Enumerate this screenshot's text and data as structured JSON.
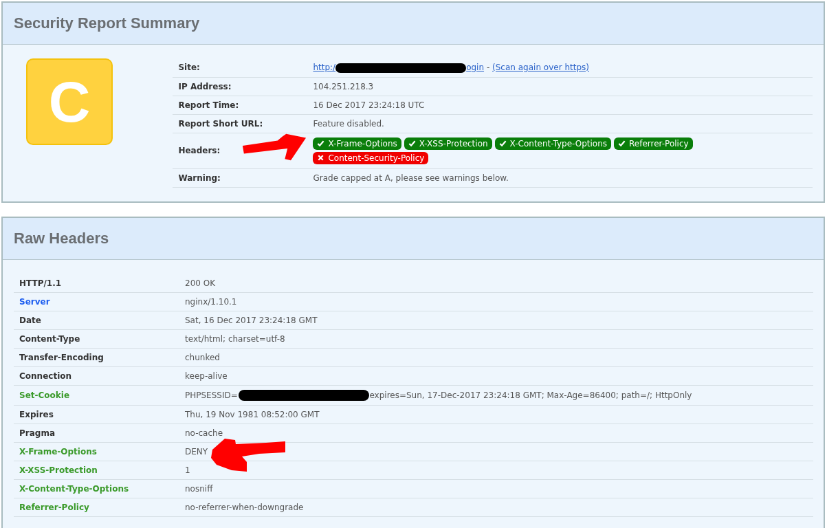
{
  "summary": {
    "title": "Security Report Summary",
    "grade": "C",
    "site": {
      "label": "Site:",
      "link_start": "http:/",
      "link_end": "ogin",
      "separator": "-",
      "rescan": "(Scan again over https)"
    },
    "rows": [
      {
        "label": "IP Address:",
        "value": "104.251.218.3"
      },
      {
        "label": "Report Time:",
        "value": "16 Dec 2017 23:24:18 UTC"
      },
      {
        "label": "Report Short URL:",
        "value": "Feature disabled."
      }
    ],
    "headers": {
      "label": "Headers:",
      "badges": [
        {
          "text": "X-Frame-Options",
          "passed": true
        },
        {
          "text": "X-XSS-Protection",
          "passed": true
        },
        {
          "text": "X-Content-Type-Options",
          "passed": true
        },
        {
          "text": "Referrer-Policy",
          "passed": true
        },
        {
          "text": "Content-Security-Policy",
          "passed": false
        }
      ]
    },
    "warning": {
      "label": "Warning:",
      "value": "Grade capped at A, please see warnings below."
    }
  },
  "raw_headers": {
    "title": "Raw Headers",
    "rows": [
      {
        "name": "HTTP/1.1",
        "value": "200 OK",
        "color": "#333333"
      },
      {
        "name": "Server",
        "value": "nginx/1.10.1",
        "color": "#1f5ff0"
      },
      {
        "name": "Date",
        "value": "Sat, 16 Dec 2017 23:24:18 GMT",
        "color": "#333333"
      },
      {
        "name": "Content-Type",
        "value": "text/html; charset=utf-8",
        "color": "#333333"
      },
      {
        "name": "Transfer-Encoding",
        "value": "chunked",
        "color": "#333333"
      },
      {
        "name": "Connection",
        "value": "keep-alive",
        "color": "#333333"
      },
      {
        "name": "Set-Cookie",
        "value": "PHPSESSID=",
        "value_end": "expires=Sun, 17-Dec-2017 23:24:18 GMT; Max-Age=86400; path=/; HttpOnly",
        "color": "#3a9a2a"
      },
      {
        "name": "Expires",
        "value": "Thu, 19 Nov 1981 08:52:00 GMT",
        "color": "#333333"
      },
      {
        "name": "Pragma",
        "value": "no-cache",
        "color": "#333333"
      },
      {
        "name": "X-Frame-Options",
        "value": "DENY",
        "color": "#3a9a2a",
        "arrow": true
      },
      {
        "name": "X-XSS-Protection",
        "value": "1",
        "color": "#3a9a2a"
      },
      {
        "name": "X-Content-Type-Options",
        "value": "nosniff",
        "color": "#3a9a2a"
      },
      {
        "name": "Referrer-Policy",
        "value": "no-referrer-when-downgrade",
        "color": "#3a9a2a"
      }
    ]
  }
}
